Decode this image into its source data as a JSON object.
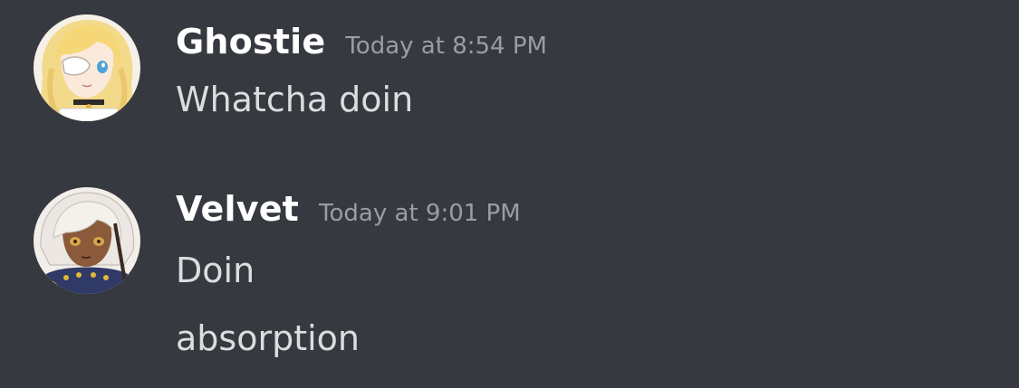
{
  "theme": {
    "background": "#36393f",
    "username_color": "#ffffff",
    "timestamp_color": "#9a9da2",
    "text_color": "#dcddde"
  },
  "messages": [
    {
      "username": "Ghostie",
      "timestamp": "Today at 8:54 PM",
      "avatar": "anime-avatar-blonde-eyepatch",
      "lines": [
        "Whatcha doin"
      ]
    },
    {
      "username": "Velvet",
      "timestamp": "Today at 9:01 PM",
      "avatar": "anime-avatar-white-hair",
      "lines": [
        "Doin",
        "absorption"
      ]
    }
  ]
}
